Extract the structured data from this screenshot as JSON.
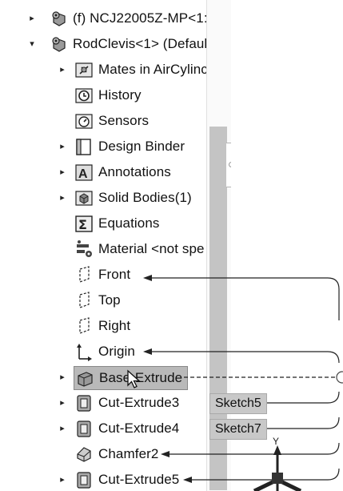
{
  "tree": {
    "items": [
      {
        "label": "(f) NCJ22005Z-MP<1:",
        "icon": "part-gear-icon",
        "arrow": "▸"
      },
      {
        "label": "RodClevis<1> (Defaul",
        "icon": "part-gear-icon",
        "arrow": "▾"
      },
      {
        "label": "Mates in AirCylinc",
        "icon": "mates-folder-icon",
        "arrow": "▸"
      },
      {
        "label": "History",
        "icon": "history-icon",
        "arrow": ""
      },
      {
        "label": "Sensors",
        "icon": "sensors-icon",
        "arrow": ""
      },
      {
        "label": "Design Binder",
        "icon": "design-binder-icon",
        "arrow": "▸"
      },
      {
        "label": "Annotations",
        "icon": "annotations-icon",
        "arrow": "▸"
      },
      {
        "label": "Solid Bodies(1)",
        "icon": "solid-bodies-icon",
        "arrow": "▸"
      },
      {
        "label": "Equations",
        "icon": "equations-icon",
        "arrow": ""
      },
      {
        "label": "Material <not spe",
        "icon": "material-icon",
        "arrow": ""
      },
      {
        "label": "Front",
        "icon": "plane-icon",
        "arrow": ""
      },
      {
        "label": "Top",
        "icon": "plane-icon",
        "arrow": ""
      },
      {
        "label": "Right",
        "icon": "plane-icon",
        "arrow": ""
      },
      {
        "label": "Origin",
        "icon": "origin-icon",
        "arrow": ""
      },
      {
        "label": "Base-Extrude",
        "icon": "extrude-icon",
        "arrow": "▸"
      },
      {
        "label": "Cut-Extrude3",
        "icon": "cut-extrude-icon",
        "arrow": "▸"
      },
      {
        "label": "Cut-Extrude4",
        "icon": "cut-extrude-icon",
        "arrow": "▸"
      },
      {
        "label": "Chamfer2",
        "icon": "chamfer-icon",
        "arrow": ""
      },
      {
        "label": "Cut-Extrude5",
        "icon": "cut-extrude-icon",
        "arrow": "▸"
      }
    ]
  },
  "tags": {
    "sketch5": "Sketch5",
    "sketch7": "Sketch7"
  },
  "triad": {
    "y_label": "Y"
  },
  "colors": {
    "selection": "#b9b9b9",
    "tag_bg": "#c8c8c8",
    "scroll_thumb": "#c4c4c4"
  }
}
